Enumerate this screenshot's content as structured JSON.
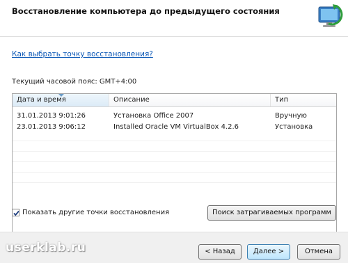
{
  "header": {
    "title": "Восстановление компьютера до предыдущего состояния",
    "icon": "system-restore-icon"
  },
  "main": {
    "help_link": "Как выбрать точку восстановления?",
    "timezone": "Текущий часовой пояс: GMT+4:00",
    "table": {
      "columns": [
        "Дата и время",
        "Описание",
        "Тип"
      ],
      "sorted_column": "Дата и время",
      "rows": [
        {
          "date": "31.01.2013 9:01:26",
          "description": "Установка Office 2007",
          "type": "Вручную"
        },
        {
          "date": "23.01.2013 9:06:12",
          "description": "Installed Oracle VM VirtualBox 4.2.6",
          "type": "Установка"
        }
      ]
    },
    "show_more_checkbox": {
      "label": "Показать другие точки восстановления",
      "checked": true
    },
    "affected_programs_button": "Поиск затрагиваемых программ"
  },
  "footer": {
    "back_button": "< Назад",
    "next_button": "Далее >",
    "cancel_button": "Отмена",
    "watermark": "userklab.ru"
  },
  "colors": {
    "link": "#0a57b6",
    "next_button_accent": "#bee6fd"
  }
}
